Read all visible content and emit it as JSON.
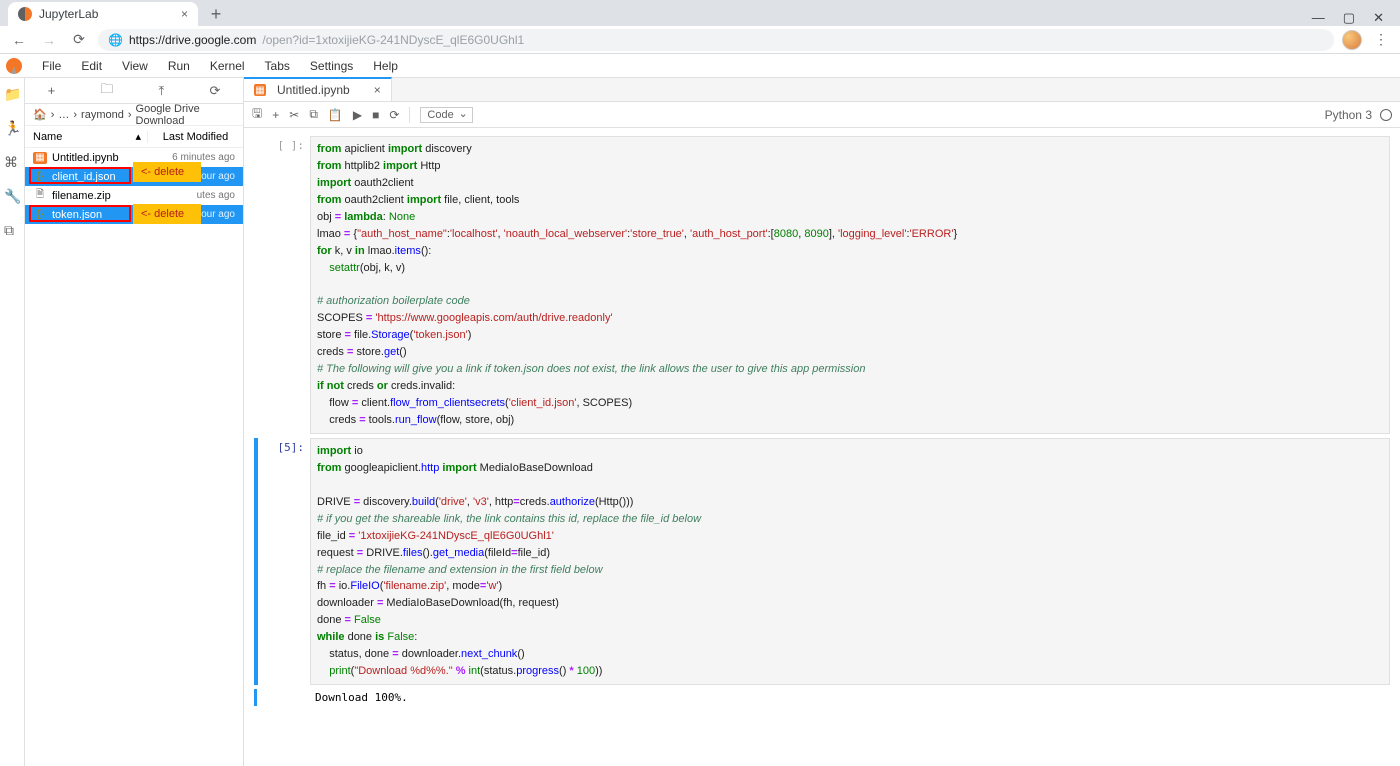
{
  "browser": {
    "tab_title": "JupyterLab",
    "url_host": "https://drive.google.com",
    "url_path": "/open?id=1xtoxijieKG-241NDyscE_qlE6G0UGhl1"
  },
  "window_controls": {
    "min": "—",
    "max": "▢",
    "close": "✕"
  },
  "menubar": [
    "File",
    "Edit",
    "View",
    "Run",
    "Kernel",
    "Tabs",
    "Settings",
    "Help"
  ],
  "file_toolbar": {
    "new": "+",
    "newfolder": "🗀",
    "upload": "⤒",
    "refresh": "⟳"
  },
  "breadcrumb": {
    "home": "🏠",
    "sep": "›",
    "dots": "…",
    "user": "raymond",
    "folder": "Google Drive Download"
  },
  "file_header": {
    "name": "Name",
    "sort": "▴",
    "modified": "Last Modified"
  },
  "files": [
    {
      "name": "Untitled.ipynb",
      "type": "nb",
      "mod": "6 minutes ago",
      "selected": false
    },
    {
      "name": "client_id.json",
      "type": "json",
      "mod": "hour ago",
      "selected": true,
      "redbox": true
    },
    {
      "name": "filename.zip",
      "type": "zip",
      "mod": "utes ago",
      "selected": false
    },
    {
      "name": "token.json",
      "type": "json",
      "mod": "hour ago",
      "selected": true,
      "redbox": true
    }
  ],
  "annotations": {
    "delete1": "<- delete",
    "delete2": "<- delete"
  },
  "nb_tab": {
    "title": "Untitled.ipynb",
    "close": "×"
  },
  "nb_toolbar": {
    "save": "🖫",
    "add": "+",
    "cut": "✂",
    "copy": "⧉",
    "paste": "📋",
    "run": "▶",
    "stop": "■",
    "restart": "⟳",
    "celltype": "Code"
  },
  "kernel": {
    "name": "Python 3"
  },
  "cells": {
    "c1_prompt": "[ ]:",
    "c2_prompt": "[5]:",
    "output": "Download 100%."
  },
  "code1": {
    "l1a": "from",
    "l1b": " apiclient ",
    "l1c": "import",
    "l1d": " discovery",
    "l2a": "from",
    "l2b": " httplib2 ",
    "l2c": "import",
    "l2d": " Http",
    "l3a": "import",
    "l3b": " oauth2client",
    "l4a": "from",
    "l4b": " oauth2client ",
    "l4c": "import",
    "l4d": " file, client, tools",
    "l5a": "obj ",
    "l5b": "=",
    "l5c": " ",
    "l5d": "lambda",
    "l5e": ": ",
    "l5f": "None",
    "l6a": "lmao ",
    "l6b": "=",
    "l6c": " {",
    "l6d": "\"auth_host_name\"",
    "l6e": ":",
    "l6f": "'localhost'",
    "l6g": ", ",
    "l6h": "'noauth_local_webserver'",
    "l6i": ":",
    "l6j": "'store_true'",
    "l6k": ", ",
    "l6l": "'auth_host_port'",
    "l6m": ":[",
    "l6n": "8080",
    "l6o": ", ",
    "l6p": "8090",
    "l6q": "], ",
    "l6r": "'logging_level'",
    "l6s": ":",
    "l6t": "'ERROR'",
    "l6u": "}",
    "l7a": "for",
    "l7b": " k, v ",
    "l7c": "in",
    "l7d": " lmao.",
    "l7e": "items",
    "l7f": "():",
    "l8a": "    ",
    "l8b": "setattr",
    "l8c": "(obj, k, v)",
    "l9": "",
    "l10": "# authorization boilerplate code",
    "l11a": "SCOPES ",
    "l11b": "=",
    "l11c": " ",
    "l11d": "'https://www.googleapis.com/auth/drive.readonly'",
    "l12a": "store ",
    "l12b": "=",
    "l12c": " file.",
    "l12d": "Storage",
    "l12e": "(",
    "l12f": "'token.json'",
    "l12g": ")",
    "l13a": "creds ",
    "l13b": "=",
    "l13c": " store.",
    "l13d": "get",
    "l13e": "()",
    "l14": "# The following will give you a link if token.json does not exist, the link allows the user to give this app permission",
    "l15a": "if",
    "l15b": " ",
    "l15c": "not",
    "l15d": " creds ",
    "l15e": "or",
    "l15f": " creds.invalid:",
    "l16a": "    flow ",
    "l16b": "=",
    "l16c": " client.",
    "l16d": "flow_from_clientsecrets",
    "l16e": "(",
    "l16f": "'client_id.json'",
    "l16g": ", SCOPES)",
    "l17a": "    creds ",
    "l17b": "=",
    "l17c": " tools.",
    "l17d": "run_flow",
    "l17e": "(flow, store, obj)"
  },
  "code2": {
    "l1a": "import",
    "l1b": " io",
    "l2a": "from",
    "l2b": " googleapiclient.",
    "l2c": "http",
    "l2d": " ",
    "l2e": "import",
    "l2f": " MediaIoBaseDownload",
    "l3": "",
    "l4a": "DRIVE ",
    "l4b": "=",
    "l4c": " discovery.",
    "l4d": "build",
    "l4e": "(",
    "l4f": "'drive'",
    "l4g": ", ",
    "l4h": "'v3'",
    "l4i": ", http",
    "l4j": "=",
    "l4k": "creds.",
    "l4l": "authorize",
    "l4m": "(Http()))",
    "l5": "# if you get the shareable link, the link contains this id, replace the file_id below",
    "l6a": "file_id ",
    "l6b": "=",
    "l6c": " ",
    "l6d": "'1xtoxijieKG-241NDyscE_qlE6G0UGhl1'",
    "l7a": "request ",
    "l7b": "=",
    "l7c": " DRIVE.",
    "l7d": "files",
    "l7e": "().",
    "l7f": "get_media",
    "l7g": "(fileId",
    "l7h": "=",
    "l7i": "file_id)",
    "l8": "# replace the filename and extension in the first field below",
    "l9a": "fh ",
    "l9b": "=",
    "l9c": " io.",
    "l9d": "FileIO",
    "l9e": "(",
    "l9f": "'filename.zip'",
    "l9g": ", mode",
    "l9h": "=",
    "l9i": "'w'",
    "l9j": ")",
    "l10a": "downloader ",
    "l10b": "=",
    "l10c": " MediaIoBaseDownload(fh, request)",
    "l11a": "done ",
    "l11b": "=",
    "l11c": " ",
    "l11d": "False",
    "l12a": "while",
    "l12b": " done ",
    "l12c": "is",
    "l12d": " ",
    "l12e": "False",
    "l12f": ":",
    "l13a": "    status, done ",
    "l13b": "=",
    "l13c": " downloader.",
    "l13d": "next_chunk",
    "l13e": "()",
    "l14a": "    ",
    "l14b": "print",
    "l14c": "(",
    "l14d": "\"Download %d%%.\"",
    "l14e": " ",
    "l14f": "%",
    "l14g": " ",
    "l14h": "int",
    "l14i": "(status.",
    "l14j": "progress",
    "l14k": "() ",
    "l14l": "*",
    "l14m": " ",
    "l14n": "100",
    "l14o": "))"
  }
}
